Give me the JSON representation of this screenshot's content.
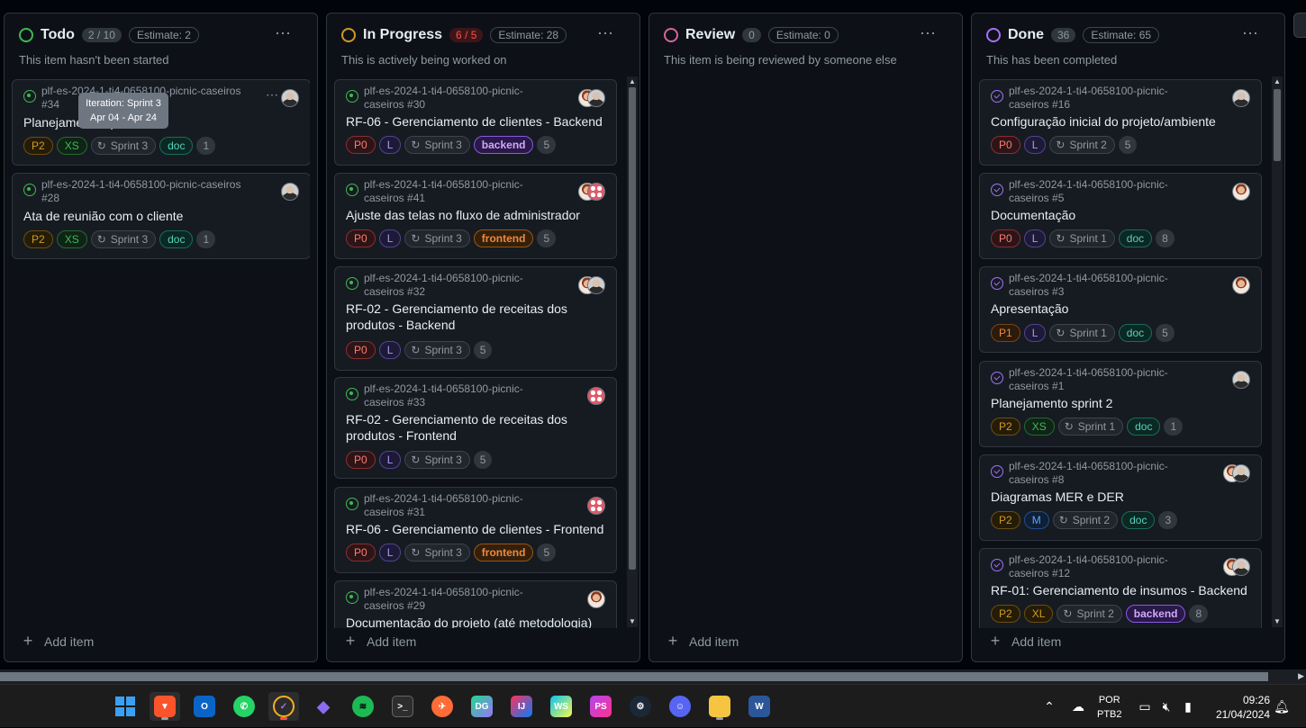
{
  "colors": {
    "todo": "#3fb950",
    "in_progress": "#d29922",
    "review": "#db61a2",
    "done": "#a371f7"
  },
  "columns": [
    {
      "name": "Todo",
      "count": "2 / 10",
      "estimate": "Estimate: 2",
      "description": "This item hasn't been started",
      "add_label": "Add item",
      "tooltip": {
        "line1": "Iteration: Sprint 3",
        "line2": "Apr 04 - Apr 24"
      },
      "cards": [
        {
          "repo": "plf-es-2024-1-ti4-0658100-picnic-caseiros",
          "number": "#34",
          "title": "Planejamento sprint 3",
          "priority": "P2",
          "size": "XS",
          "sprint": "Sprint 3",
          "label": "doc",
          "estimate": "1"
        },
        {
          "repo": "plf-es-2024-1-ti4-0658100-picnic-caseiros",
          "number": "#28",
          "title": "Ata de reunião com o cliente",
          "priority": "P2",
          "size": "XS",
          "sprint": "Sprint 3",
          "label": "doc",
          "estimate": "1"
        }
      ]
    },
    {
      "name": "In Progress",
      "count": "6 / 5",
      "estimate": "Estimate: 28",
      "description": "This is actively being worked on",
      "add_label": "Add item",
      "cards": [
        {
          "repo": "plf-es-2024-1-ti4-0658100-picnic-",
          "number": "caseiros #30",
          "title": "RF-06 - Gerenciamento de clientes - Backend",
          "priority": "P0",
          "size": "L",
          "sprint": "Sprint 3",
          "label": "backend",
          "estimate": "5"
        },
        {
          "repo": "plf-es-2024-1-ti4-0658100-picnic-",
          "number": "caseiros #41",
          "title": "Ajuste das telas no fluxo de administrador",
          "priority": "P0",
          "size": "L",
          "sprint": "Sprint 3",
          "label": "frontend",
          "estimate": "5"
        },
        {
          "repo": "plf-es-2024-1-ti4-0658100-picnic-",
          "number": "caseiros #32",
          "title": "RF-02 - Gerenciamento de receitas dos produtos - Backend",
          "priority": "P0",
          "size": "L",
          "sprint": "Sprint 3",
          "label": "",
          "estimate": "5"
        },
        {
          "repo": "plf-es-2024-1-ti4-0658100-picnic-",
          "number": "caseiros #33",
          "title": "RF-02 - Gerenciamento de receitas dos produtos - Frontend",
          "priority": "P0",
          "size": "L",
          "sprint": "Sprint 3",
          "label": "",
          "estimate": "5"
        },
        {
          "repo": "plf-es-2024-1-ti4-0658100-picnic-",
          "number": "caseiros #31",
          "title": "RF-06 - Gerenciamento de clientes - Frontend",
          "priority": "P0",
          "size": "L",
          "sprint": "Sprint 3",
          "label": "frontend",
          "estimate": "5"
        },
        {
          "repo": "plf-es-2024-1-ti4-0658100-picnic-",
          "number": "caseiros #29",
          "title": "Documentação do projeto (até metodologia)"
        }
      ]
    },
    {
      "name": "Review",
      "count": "0",
      "estimate": "Estimate: 0",
      "description": "This item is being reviewed by someone else",
      "add_label": "Add item",
      "cards": []
    },
    {
      "name": "Done",
      "count": "36",
      "estimate": "Estimate: 65",
      "description": "This has been completed",
      "add_label": "Add item",
      "cards": [
        {
          "repo": "plf-es-2024-1-ti4-0658100-picnic-",
          "number": "caseiros #16",
          "title": "Configuração inicial do projeto/ambiente",
          "priority": "P0",
          "size": "L",
          "sprint": "Sprint 2",
          "label": "",
          "estimate": "5"
        },
        {
          "repo": "plf-es-2024-1-ti4-0658100-picnic-",
          "number": "caseiros #5",
          "title": "Documentação",
          "priority": "P0",
          "size": "L",
          "sprint": "Sprint 1",
          "label": "doc",
          "estimate": "8"
        },
        {
          "repo": "plf-es-2024-1-ti4-0658100-picnic-",
          "number": "caseiros #3",
          "title": "Apresentação",
          "priority": "P1",
          "size": "L",
          "sprint": "Sprint 1",
          "label": "doc",
          "estimate": "5"
        },
        {
          "repo": "plf-es-2024-1-ti4-0658100-picnic-",
          "number": "caseiros #1",
          "title": "Planejamento sprint 2",
          "priority": "P2",
          "size": "XS",
          "sprint": "Sprint 1",
          "label": "doc",
          "estimate": "1"
        },
        {
          "repo": "plf-es-2024-1-ti4-0658100-picnic-",
          "number": "caseiros #8",
          "title": "Diagramas MER e DER",
          "priority": "P2",
          "size": "M",
          "sprint": "Sprint 2",
          "label": "doc",
          "estimate": "3"
        },
        {
          "repo": "plf-es-2024-1-ti4-0658100-picnic-",
          "number": "caseiros #12",
          "title": "RF-01: Gerenciamento de insumos - Backend",
          "priority": "P2",
          "size": "XL",
          "sprint": "Sprint 2",
          "label": "backend",
          "estimate": "8"
        }
      ]
    }
  ],
  "taskbar": {
    "apps": [
      "windows-start",
      "brave",
      "outlook-new",
      "whatsapp",
      "todo-app",
      "obsidian",
      "spotify",
      "terminal",
      "postman",
      "datagrip",
      "intellij",
      "webstorm",
      "phpstorm",
      "steam",
      "discord",
      "file-explorer",
      "word"
    ],
    "lang_top": "POR",
    "lang_bottom": "PTB2",
    "time": "09:26",
    "date": "21/04/2024"
  }
}
